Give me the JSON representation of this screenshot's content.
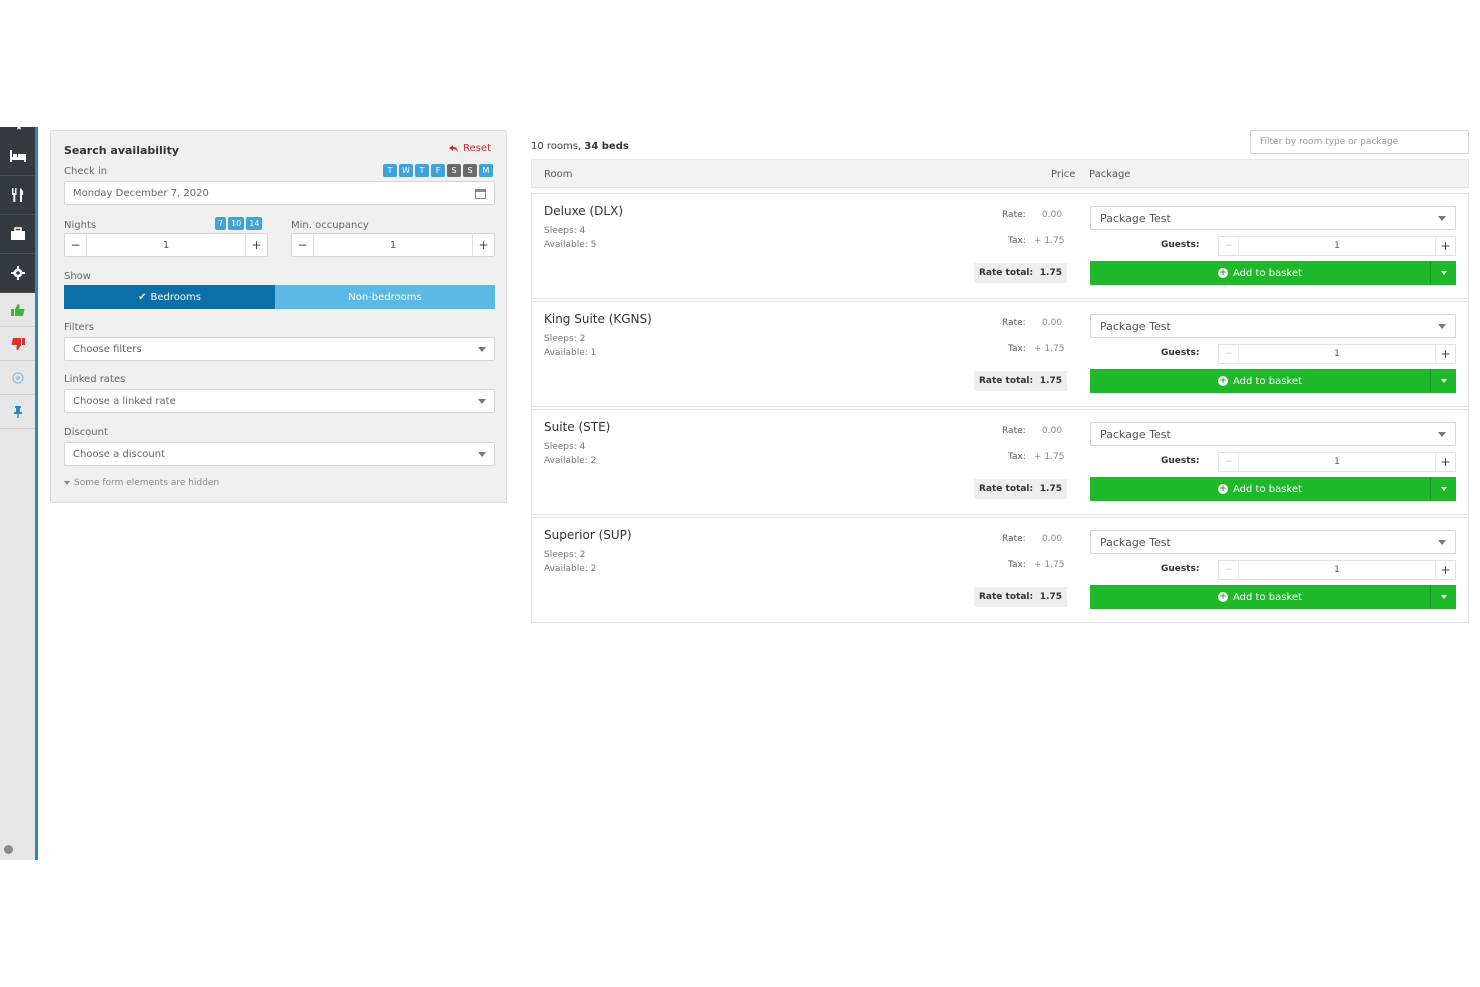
{
  "search": {
    "title": "Search availability",
    "reset_label": "Reset",
    "checkin_label": "Check in",
    "checkin_value": "Monday December 7, 2020",
    "days": [
      "T",
      "W",
      "T",
      "F",
      "S",
      "S",
      "M"
    ],
    "nights_label": "Nights",
    "nights_options": [
      "7",
      "10",
      "14"
    ],
    "nights_value": "1",
    "min_occupancy_label": "Min. occupancy",
    "min_occupancy_value": "1",
    "show_label": "Show",
    "show_bedrooms": "Bedrooms",
    "show_nonbedrooms": "Non-bedrooms",
    "filters_label": "Filters",
    "filters_placeholder": "Choose filters",
    "linked_label": "Linked rates",
    "linked_placeholder": "Choose a linked rate",
    "discount_label": "Discount",
    "discount_placeholder": "Choose a discount",
    "hidden_note": "Some form elements are hidden"
  },
  "results": {
    "summary_rooms": "10 rooms,",
    "summary_beds": "34 beds",
    "filter_placeholder": "Filter by room type or package",
    "col_room": "Room",
    "col_price": "Price",
    "col_package": "Package",
    "rooms": [
      {
        "name": "Deluxe (DLX)",
        "sleeps": "Sleeps: 4",
        "available": "Available: 5",
        "rate_label": "Rate:",
        "rate": "0.00",
        "tax_label": "Tax:",
        "tax": "+ 1.75",
        "total_label": "Rate total:",
        "total": "1.75",
        "package": "Package Test",
        "guests_label": "Guests:",
        "guests": "1",
        "add_label": "Add to basket"
      },
      {
        "name": "King Suite (KGNS)",
        "sleeps": "Sleeps: 2",
        "available": "Available: 1",
        "rate_label": "Rate:",
        "rate": "0.00",
        "tax_label": "Tax:",
        "tax": "+ 1.75",
        "total_label": "Rate total:",
        "total": "1.75",
        "package": "Package Test",
        "guests_label": "Guests:",
        "guests": "1",
        "add_label": "Add to basket"
      },
      {
        "name": "Suite (STE)",
        "sleeps": "Sleeps: 4",
        "available": "Available: 2",
        "rate_label": "Rate:",
        "rate": "0.00",
        "tax_label": "Tax:",
        "tax": "+ 1.75",
        "total_label": "Rate total:",
        "total": "1.75",
        "package": "Package Test",
        "guests_label": "Guests:",
        "guests": "1",
        "add_label": "Add to basket"
      },
      {
        "name": "Superior (SUP)",
        "sleeps": "Sleeps: 2",
        "available": "Available: 2",
        "rate_label": "Rate:",
        "rate": "0.00",
        "tax_label": "Tax:",
        "tax": "+ 1.75",
        "total_label": "Rate total:",
        "total": "1.75",
        "package": "Package Test",
        "guests_label": "Guests:",
        "guests": "1",
        "add_label": "Add to basket"
      }
    ]
  },
  "sidebar": {
    "icons": [
      "bed-icon",
      "restaurant-icon",
      "briefcase-icon",
      "gear-icon",
      "thumbs-up-icon",
      "thumbs-down-icon",
      "circle-icon",
      "pin-icon"
    ]
  },
  "colors": {
    "primary_blue": "#0d6fa8",
    "light_blue": "#5cb8e4",
    "green": "#1fb82a",
    "sidebar_dark": "#343a40",
    "reset_red": "#c9302c"
  }
}
